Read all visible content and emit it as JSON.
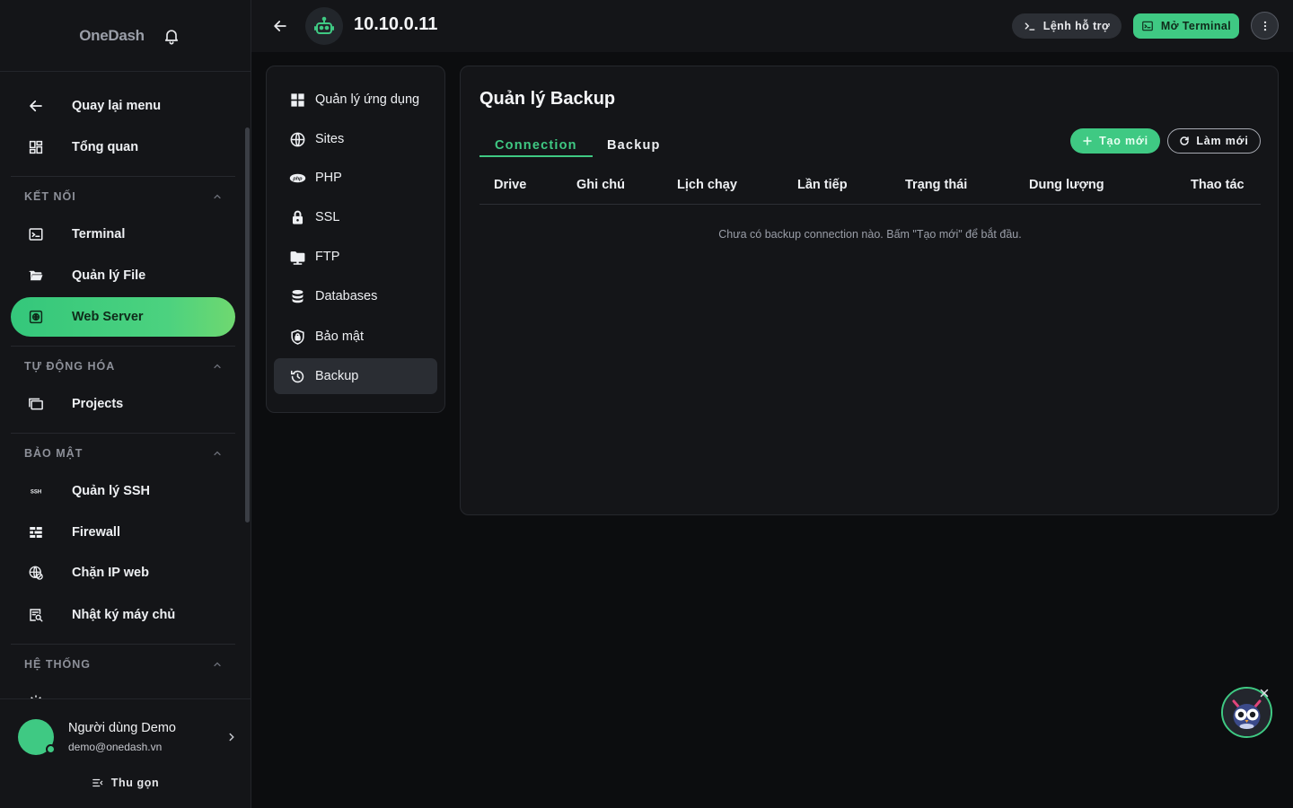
{
  "brand": {
    "name": "OneDash"
  },
  "sidebar": {
    "top_items": [
      {
        "label": "Quay lại menu",
        "icon": "arrow-left-icon"
      },
      {
        "label": "Tổng quan",
        "icon": "dashboard-icon"
      }
    ],
    "sections": [
      {
        "title": "KẾT NỐI",
        "items": [
          {
            "label": "Terminal",
            "icon": "terminal-icon"
          },
          {
            "label": "Quản lý File",
            "icon": "folder-icon"
          },
          {
            "label": "Web Server",
            "icon": "web-server-icon",
            "active": true
          }
        ]
      },
      {
        "title": "TỰ ĐỘNG HÓA",
        "items": [
          {
            "label": "Projects",
            "icon": "projects-icon"
          }
        ]
      },
      {
        "title": "BẢO MẬT",
        "items": [
          {
            "label": "Quản lý SSH",
            "icon": "ssh-icon"
          },
          {
            "label": "Firewall",
            "icon": "firewall-icon"
          },
          {
            "label": "Chặn IP web",
            "icon": "block-ip-icon"
          },
          {
            "label": "Nhật ký máy chủ",
            "icon": "server-log-icon"
          }
        ]
      },
      {
        "title": "HỆ THỐNG",
        "items": []
      }
    ],
    "ssh_icon_text": "SSH"
  },
  "user": {
    "name": "Người dùng Demo",
    "email": "demo@onedash.vn"
  },
  "collapse_label": "Thu gọn",
  "topbar": {
    "server_title": "10.10.0.11",
    "hint_button": "Lệnh hỗ trợ",
    "terminal_button": "Mở Terminal"
  },
  "app_menu": {
    "items": [
      {
        "label": "Quản lý ứng dụng",
        "icon": "apps-grid-icon"
      },
      {
        "label": "Sites",
        "icon": "globe-icon"
      },
      {
        "label": "PHP",
        "icon": "php-icon"
      },
      {
        "label": "SSL",
        "icon": "lock-icon"
      },
      {
        "label": "FTP",
        "icon": "ftp-folder-icon"
      },
      {
        "label": "Databases",
        "icon": "database-icon"
      },
      {
        "label": "Bảo mật",
        "icon": "shield-icon"
      },
      {
        "label": "Backup",
        "icon": "backup-icon",
        "active": true
      }
    ],
    "php_icon_text": "php"
  },
  "main": {
    "title": "Quản lý Backup",
    "tabs": [
      {
        "label": "Connection",
        "active": true
      },
      {
        "label": "Backup",
        "active": false
      }
    ],
    "new_button": "Tạo mới",
    "refresh_button": "Làm mới",
    "table": {
      "columns": [
        "Drive",
        "Ghi chú",
        "Lịch chạy",
        "Lần tiếp",
        "Trạng thái",
        "Dung lượng",
        "Thao tác"
      ],
      "rows": [],
      "empty_message": "Chưa có backup connection nào. Bấm \"Tạo mới\" để bắt đầu."
    }
  },
  "colors": {
    "accent": "#3fc983",
    "background": "#0c0d0f",
    "panel": "#141518"
  }
}
